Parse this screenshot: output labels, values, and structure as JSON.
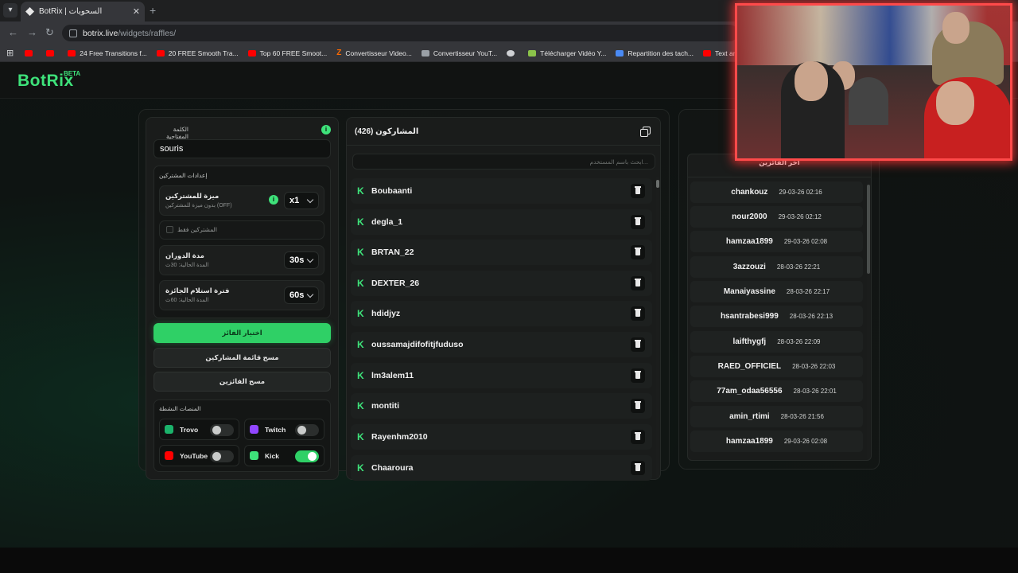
{
  "browser": {
    "tab_title": "BotRix | السحوبات",
    "url_host": "botrix.live",
    "url_path": "/widgets/raffles/",
    "bookmarks": [
      {
        "label": "",
        "icon": "youtube-icon"
      },
      {
        "label": "",
        "icon": "youtube-icon"
      },
      {
        "label": "24 Free Transitions f...",
        "icon": "youtube-icon"
      },
      {
        "label": "20 FREE Smooth Tra...",
        "icon": "youtube-icon"
      },
      {
        "label": "Top 60 FREE Smoot...",
        "icon": "youtube-icon"
      },
      {
        "label": "Convertisseur Video...",
        "icon": "z-icon"
      },
      {
        "label": "Convertisseur YouT...",
        "icon": "gears-icon"
      },
      {
        "label": "",
        "icon": "globe-icon"
      },
      {
        "label": "Télécharger Vidéo Y...",
        "icon": "download-icon"
      },
      {
        "label": "Repartition des tach...",
        "icon": "docs-icon"
      },
      {
        "label": "Text and Image ani...",
        "icon": "youtube-icon"
      }
    ]
  },
  "app": {
    "logo": "BotRix",
    "beta": "BETA",
    "accent": "#3ee27a"
  },
  "settings": {
    "keyword_label": "الكلمة المفتاحية",
    "keyword_value": "souris",
    "subs_section": "إعدادات المشتركين",
    "sub_bonus_title": "ميزة للمشتركين",
    "sub_bonus_sub": "بدون ميزة للمشتركين (OFF)",
    "sub_bonus_value": "x1",
    "subs_only_label": "المشتركين فقط",
    "spin_title": "مدة الدوران",
    "spin_sub": "المدة الحالية: 30ث",
    "spin_value": "30s",
    "claim_title": "فترة استلام الجائزة",
    "claim_sub": "المدة الحالية: 60ث",
    "claim_value": "60s",
    "pick_winner": "اختيار الفائز",
    "clear_participants": "مسح قائمة المشاركين",
    "clear_winners": "مسح الفائزين",
    "platforms_title": "المنصات النشطة",
    "platforms": [
      {
        "name": "Trovo",
        "on": false
      },
      {
        "name": "Twitch",
        "on": false
      },
      {
        "name": "YouTube",
        "on": false
      },
      {
        "name": "Kick",
        "on": true
      }
    ]
  },
  "participants": {
    "title": "المشاركون (426)",
    "search_placeholder": "ابحث باسم المستخدم...",
    "items": [
      "Boubaanti",
      "degla_1",
      "BRTAN_22",
      "DEXTER_26",
      "hdidjyz",
      "oussamajdifofitjfuduso",
      "lm3alem11",
      "montiti",
      "Rayenhm2010",
      "Chaaroura"
    ]
  },
  "winners": {
    "title": "آخر الفائزين",
    "items": [
      {
        "name": "chankouz",
        "date": "29-03-26 02:16"
      },
      {
        "name": "nour2000",
        "date": "29-03-26 02:12"
      },
      {
        "name": "hamzaa1899",
        "date": "29-03-26 02:08"
      },
      {
        "name": "3azzouzi",
        "date": "28-03-26 22:21"
      },
      {
        "name": "Manaiyassine",
        "date": "28-03-26 22:17"
      },
      {
        "name": "hsantrabesi999",
        "date": "28-03-26 22:13"
      },
      {
        "name": "laifthygfj",
        "date": "28-03-26 22:09"
      },
      {
        "name": "RAED_OFFICIEL",
        "date": "28-03-26 22:03"
      },
      {
        "name": "77am_odaa56556",
        "date": "28-03-26 22:01"
      },
      {
        "name": "amin_rtimi",
        "date": "28-03-26 21:56"
      },
      {
        "name": "hamzaa1899",
        "date": "29-03-26 02:08"
      }
    ]
  }
}
